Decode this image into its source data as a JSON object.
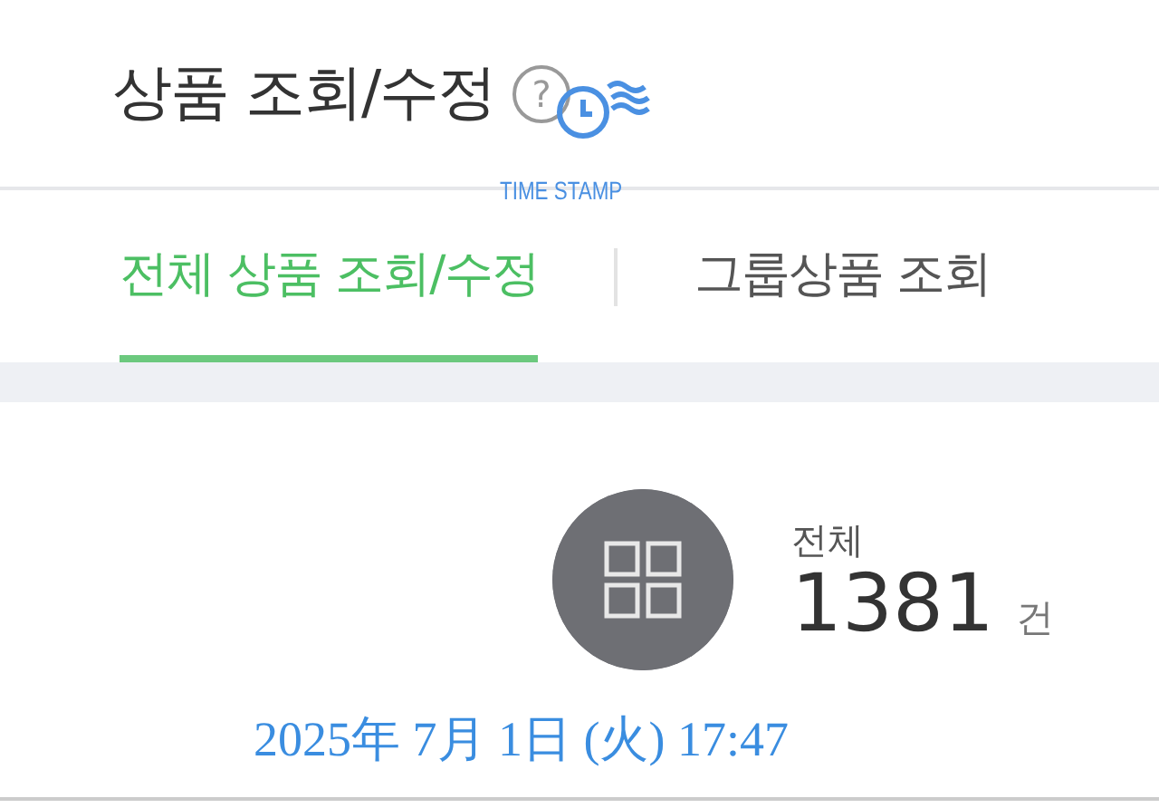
{
  "page": {
    "title": "상품 조회/수정",
    "help": "?"
  },
  "tabs": [
    {
      "label": "전체 상품 조회/수정",
      "selected": true
    },
    {
      "label": "그룹상품 조회",
      "selected": false
    }
  ],
  "summary": {
    "label": "전체",
    "count": "1381",
    "unit": "건"
  },
  "timestamp": {
    "stamp_label": "TIME STAMP",
    "date": "2025年 7月 1日 (火) 17:47"
  }
}
